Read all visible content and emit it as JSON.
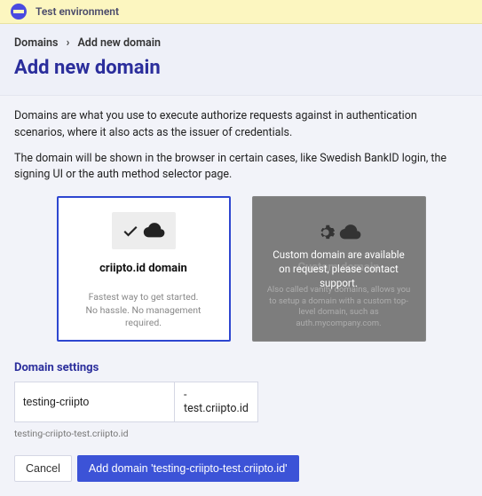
{
  "banner": {
    "text": "Test environment"
  },
  "breadcrumb": {
    "root": "Domains",
    "current": "Add new domain"
  },
  "page_title": "Add new domain",
  "desc1": "Domains are what you use to execute authorize requests against in authentication scenarios, where it also acts as the issuer of credentials.",
  "desc2": "The domain will be shown in the browser in certain cases, like Swedish BankID login, the signing UI or the auth method selector page.",
  "card_criipto": {
    "title": "criipto.id domain",
    "sub1": "Fastest way to get started.",
    "sub2": "No hassle. No management required."
  },
  "card_custom": {
    "title": "Custom domain",
    "overlay": "Custom domain are available on request, please contact support.",
    "sub": "Also called vanity domains, allows you to setup a domain with a custom top-level domain, such as auth.mycompany.com."
  },
  "settings": {
    "label": "Domain settings",
    "value": "testing-criipto",
    "suffix": "-test.criipto.id",
    "preview": "testing-criipto-test.criipto.id"
  },
  "buttons": {
    "cancel": "Cancel",
    "submit": "Add domain 'testing-criipto-test.criipto.id'"
  }
}
